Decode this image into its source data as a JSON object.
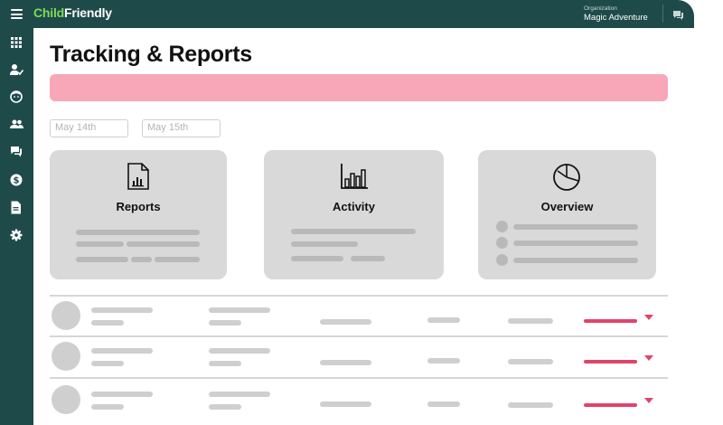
{
  "app": {
    "logo_part1": "Child",
    "logo_part2": "Friendly",
    "org_label": "Organization",
    "org_name": "Magic Adventure"
  },
  "sidebar": {
    "items": [
      {
        "icon": "grid-icon"
      },
      {
        "icon": "user-check-icon"
      },
      {
        "icon": "child-face-icon"
      },
      {
        "icon": "users-icon"
      },
      {
        "icon": "chat-icon"
      },
      {
        "icon": "dollar-icon"
      },
      {
        "icon": "document-icon"
      },
      {
        "icon": "gear-icon"
      }
    ]
  },
  "page": {
    "title": "Tracking & Reports"
  },
  "filters": {
    "date_start": "May 14th",
    "date_end": "May 15th"
  },
  "cards": [
    {
      "title": "Reports",
      "icon": "report-document-icon"
    },
    {
      "title": "Activity",
      "icon": "bar-chart-icon"
    },
    {
      "title": "Overview",
      "icon": "pie-chart-icon"
    }
  ],
  "colors": {
    "sidebar": "#1f4a4a",
    "accent": "#e2436a",
    "banner": "#f7a7b8",
    "logo_green": "#7ed957"
  }
}
